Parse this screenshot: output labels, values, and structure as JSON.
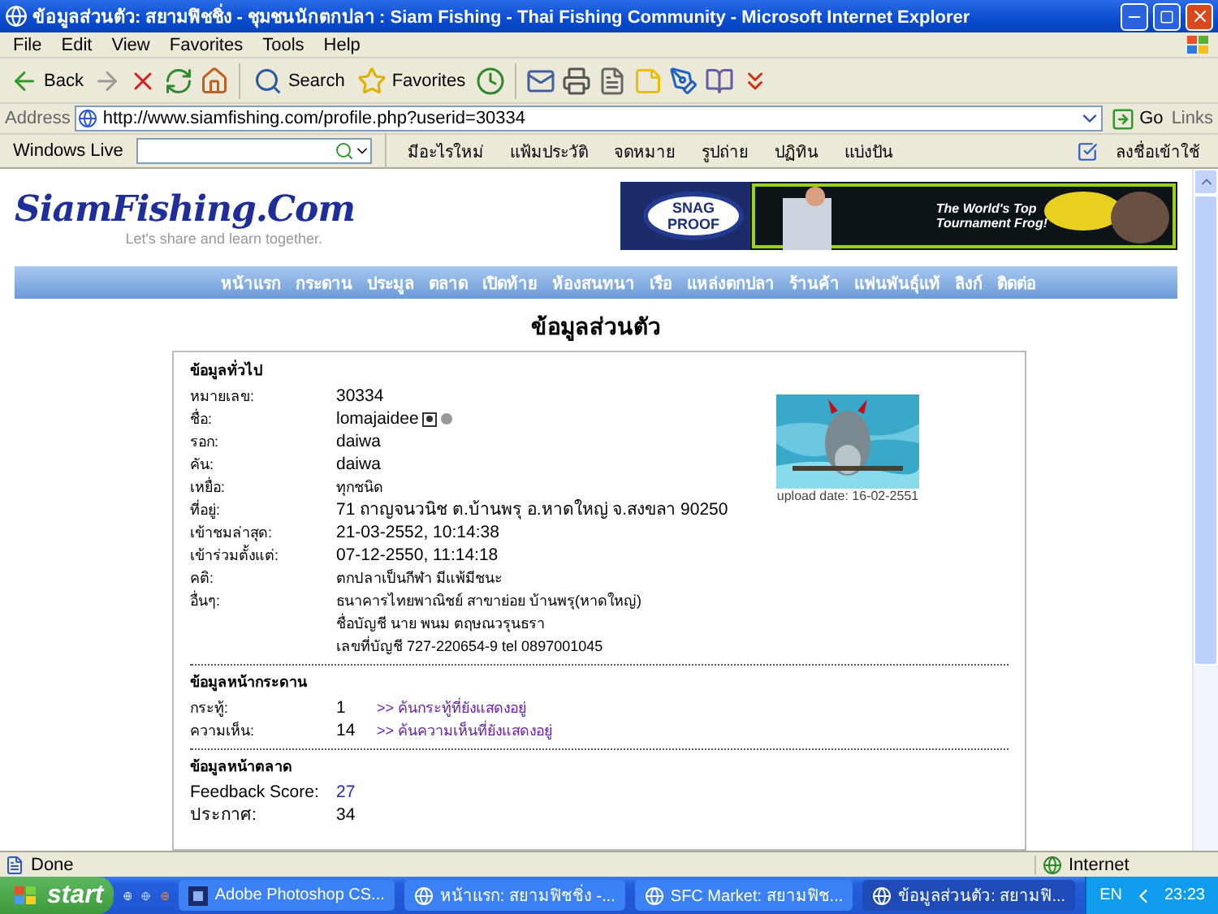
{
  "window": {
    "title": "ข้อมูลส่วนตัว: สยามฟิชชิ่ง - ชุมชนนักตกปลา : Siam Fishing - Thai Fishing Community - Microsoft Internet Explorer"
  },
  "menu": [
    "File",
    "Edit",
    "View",
    "Favorites",
    "Tools",
    "Help"
  ],
  "toolbar": [
    {
      "kind": "back",
      "label": "Back"
    },
    {
      "kind": "forward"
    },
    {
      "kind": "stop"
    },
    {
      "kind": "refresh"
    },
    {
      "kind": "home"
    },
    {
      "kind": "search",
      "label": "Search"
    },
    {
      "kind": "favorites",
      "label": "Favorites"
    },
    {
      "kind": "history"
    },
    {
      "kind": "mail"
    },
    {
      "kind": "print"
    },
    {
      "kind": "edit"
    },
    {
      "kind": "note"
    },
    {
      "kind": "pen"
    },
    {
      "kind": "research"
    },
    {
      "kind": "download"
    }
  ],
  "address": {
    "label": "Address",
    "value": "http://www.siamfishing.com/profile.php?userid=30334",
    "go": "Go",
    "links": "Links"
  },
  "links_bar": {
    "brand": "Windows Live",
    "items": [
      "มีอะไรใหม่",
      "แฟ้มประวัติ",
      "จดหมาย",
      "รูปถ่าย",
      "ปฏิทิน",
      "แบ่งปัน"
    ],
    "sign_in": "ลงชื่อเข้าใช้"
  },
  "site": {
    "logo": "SiamFishing.Com",
    "tagline": "Let's share and learn together.",
    "banner": {
      "brand_top": "SNAG",
      "brand_bottom": "PROOF",
      "slogan_1": "The World's Top",
      "slogan_2": "Tournament Frog!"
    },
    "nav": [
      "หน้าแรก",
      "กระดาน",
      "ประมูล",
      "ตลาด",
      "เปิดท้าย",
      "ห้องสนทนา",
      "เรือ",
      "แหล่งตกปลา",
      "ร้านค้า",
      "แฟนพันธุ์แท้",
      "ลิงก์",
      "ติดต่อ"
    ],
    "heading": "ข้อมูลส่วนตัว"
  },
  "general": {
    "title": "ข้อมูลทั่วไป",
    "upload_date": "upload date: 16-02-2551",
    "rows": [
      {
        "label": "หมายเลข:",
        "lines": [
          "30334"
        ],
        "kind": "plain"
      },
      {
        "label": "ชื่อ:",
        "lines": [
          "lomajaidee"
        ],
        "kind": "user"
      },
      {
        "label": "รอก:",
        "lines": [
          "daiwa"
        ],
        "kind": "plain"
      },
      {
        "label": "คัน:",
        "lines": [
          "daiwa"
        ],
        "kind": "plain"
      },
      {
        "label": "เหยื่อ:",
        "lines": [
          "ทุกชนิด"
        ],
        "kind": "small"
      },
      {
        "label": "ที่อยู่:",
        "lines": [
          "71 ถาญจนวนิช ต.บ้านพรุ อ.หาดใหญ่ จ.สงขลา 90250"
        ],
        "kind": "plain"
      },
      {
        "label": "เข้าชมล่าสุด:",
        "lines": [
          "21-03-2552, 10:14:38"
        ],
        "kind": "plain"
      },
      {
        "label": "เข้าร่วมตั้งแต่:",
        "lines": [
          "07-12-2550, 11:14:18"
        ],
        "kind": "plain"
      },
      {
        "label": "คติ:",
        "lines": [
          "ตกปลาเป็นกีฬา มีแพ้มีชนะ"
        ],
        "kind": "small"
      },
      {
        "label": "อื่นๆ:",
        "lines": [
          "ธนาคารไทยพาณิชย์ สาขาย่อย บ้านพรุ(หาดใหญ่)",
          "ชื่อบัญชี นาย พนม ตฤษณวรุนธรา",
          "เลขที่บัญชี 727-220654-9 tel 0897001045"
        ],
        "kind": "small"
      }
    ]
  },
  "board": {
    "title": "ข้อมูลหน้ากระดาน",
    "rows": [
      {
        "label": "กระทู้:",
        "value": "1",
        "link": ">> ค้นกระทู้ที่ยังแสดงอยู่"
      },
      {
        "label": "ความเห็น:",
        "value": "14",
        "link": ">> ค้นความเห็นที่ยังแสดงอยู่"
      }
    ]
  },
  "market": {
    "title": "ข้อมูลหน้าตลาด",
    "rows": [
      {
        "label": "Feedback Score:",
        "value": "27",
        "kind": "link"
      },
      {
        "label": "ประกาศ:",
        "value": "34",
        "kind": "plain"
      }
    ]
  },
  "status_bar": {
    "text": "Done",
    "zone": "Internet"
  },
  "taskbar": {
    "start": "start",
    "tasks": [
      {
        "label": "Adobe Photoshop CS...",
        "kind": "photoshop",
        "selected": false
      },
      {
        "label": "หน้าแรก: สยามฟิชชิ่ง -...",
        "kind": "ie",
        "selected": false
      },
      {
        "label": "SFC Market: สยามฟิช...",
        "kind": "ie",
        "selected": false
      },
      {
        "label": "ข้อมูลส่วนตัว: สยามฟิ...",
        "kind": "ie",
        "selected": true
      }
    ],
    "language": "EN",
    "clock": "23:23"
  }
}
